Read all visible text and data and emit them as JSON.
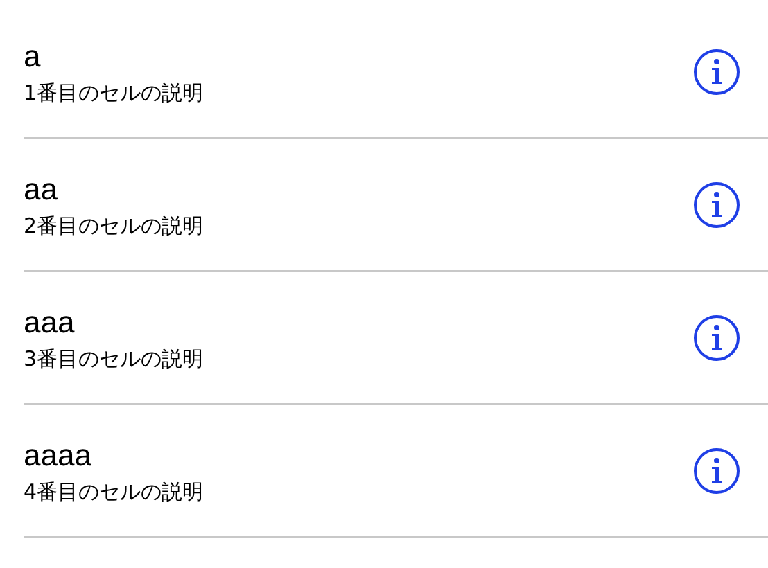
{
  "cells": [
    {
      "title": "a",
      "subtitle": "1番目のセルの説明"
    },
    {
      "title": "aa",
      "subtitle": "2番目のセルの説明"
    },
    {
      "title": "aaa",
      "subtitle": "3番目のセルの説明"
    },
    {
      "title": "aaaa",
      "subtitle": "4番目のセルの説明"
    }
  ]
}
